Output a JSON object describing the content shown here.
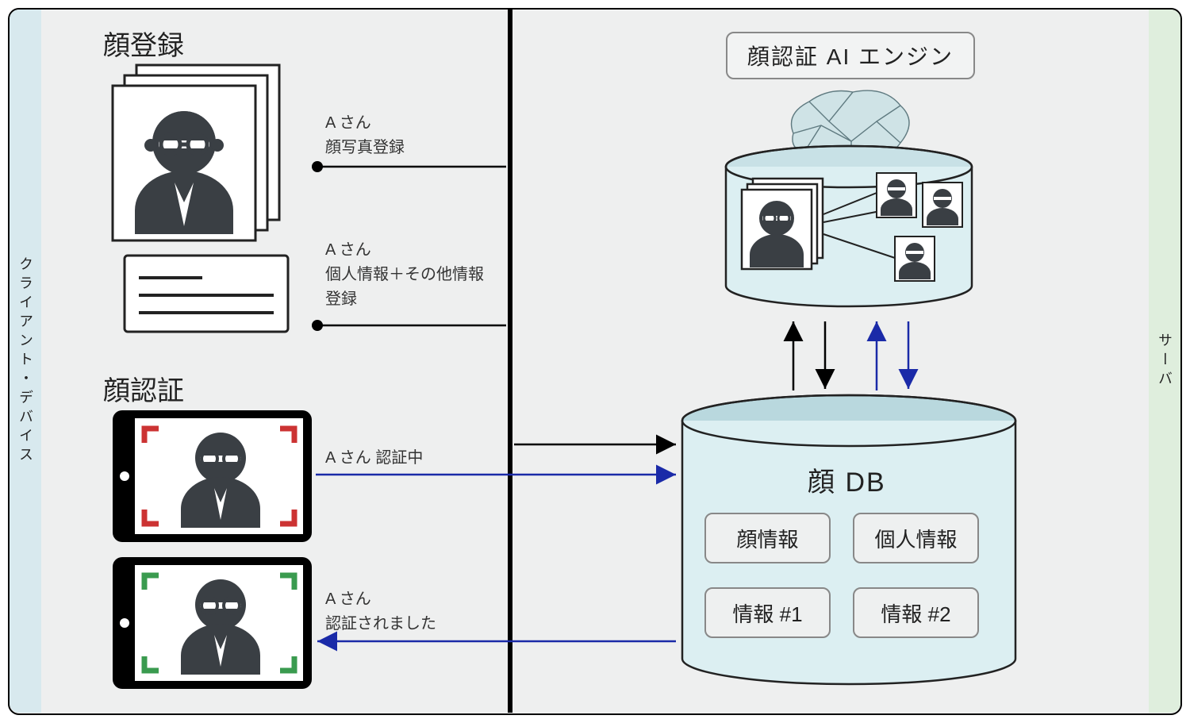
{
  "labels": {
    "client": "クライアント・デバイス",
    "server": "サーバ"
  },
  "sections": {
    "register_title": "顔登録",
    "auth_title": "顔認証"
  },
  "register": {
    "photo_line1": "A さん",
    "photo_line2": "顔写真登録",
    "info_line1": "A さん",
    "info_line2": "個人情報＋その他情報",
    "info_line3": "登録"
  },
  "auth": {
    "progress_label": "A さん 認証中",
    "done_line1": "A さん",
    "done_line2": "認証されました"
  },
  "server": {
    "engine_label": "顔認証 AI エンジン",
    "db_title": "顔 DB",
    "db_items": {
      "face_info": "顔情報",
      "personal_info": "個人情報",
      "info1": "情報 #1",
      "info2": "情報 #2"
    }
  }
}
